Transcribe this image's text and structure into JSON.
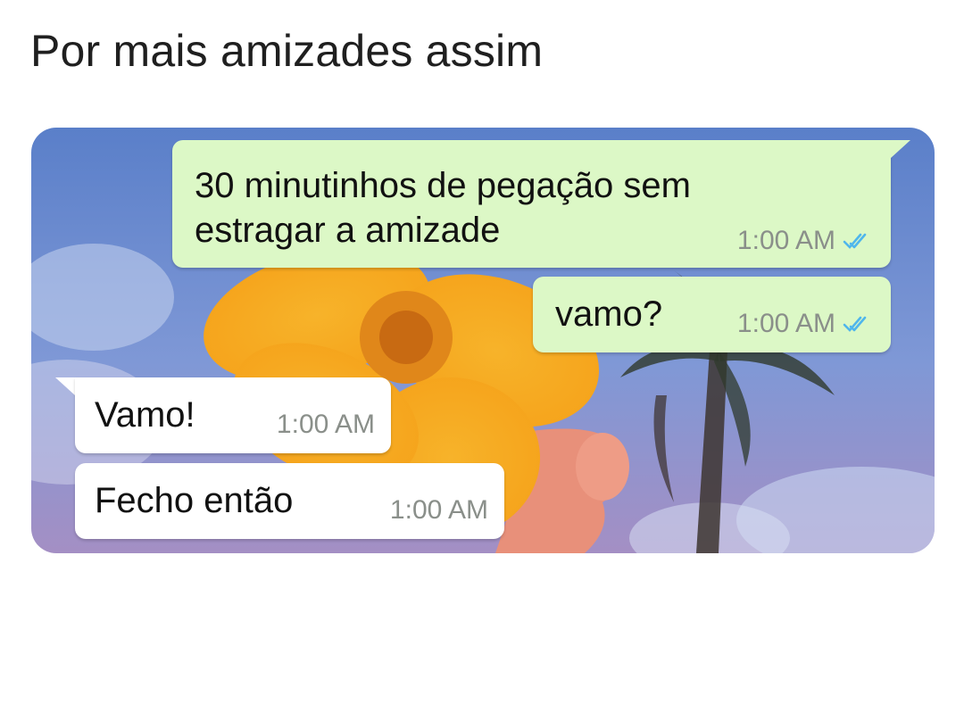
{
  "caption": "Por mais amizades assim",
  "messages": [
    {
      "direction": "outgoing",
      "text_line1": "30 minutinhos de pegação sem",
      "text_line2": "estragar a amizade",
      "time": "1:00 AM",
      "status_icon": "double-check-read-icon"
    },
    {
      "direction": "outgoing",
      "text": "vamo?",
      "time": "1:00 AM",
      "status_icon": "double-check-read-icon"
    },
    {
      "direction": "incoming",
      "text": "Vamo!",
      "time": "1:00 AM"
    },
    {
      "direction": "incoming",
      "text": "Fecho então",
      "time": "1:00 AM"
    }
  ],
  "colors": {
    "outgoing_bubble": "#dcf8c6",
    "incoming_bubble": "#ffffff",
    "read_ticks": "#4fb6ec",
    "timestamp": "#8a8f8a"
  }
}
